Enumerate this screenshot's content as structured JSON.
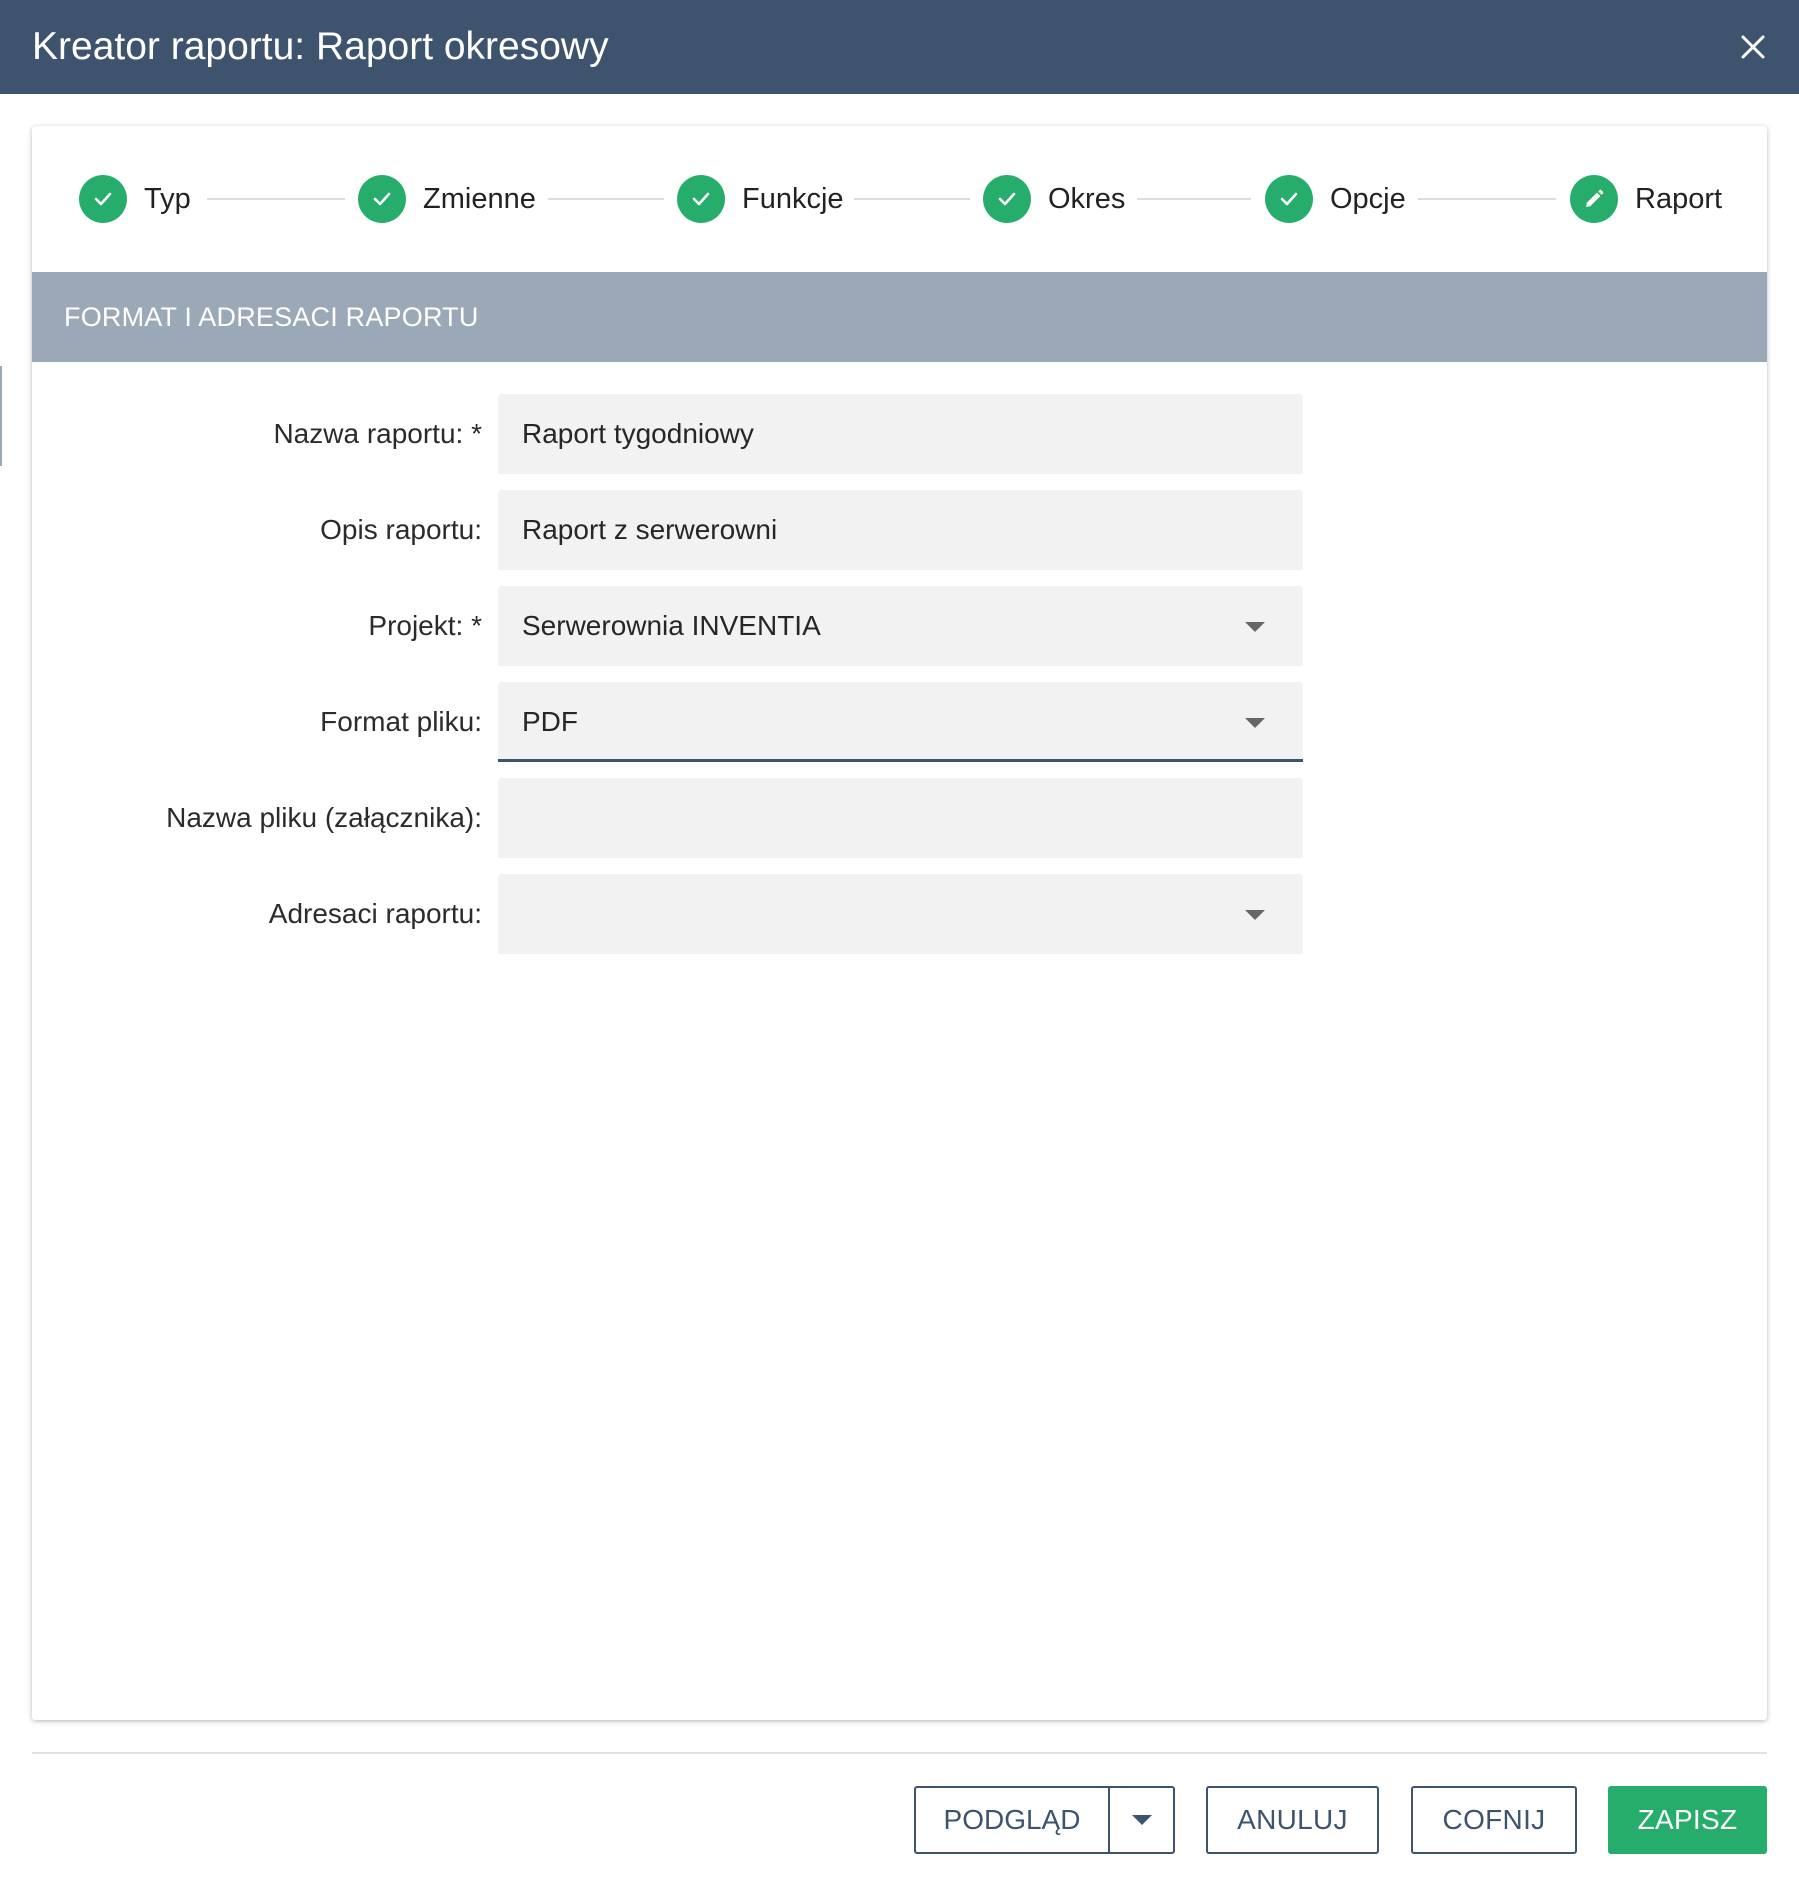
{
  "dialog": {
    "title": "Kreator raportu: Raport okresowy",
    "close_icon": "close-icon"
  },
  "stepper": {
    "steps": [
      {
        "label": "Typ",
        "state": "done",
        "icon": "check-icon"
      },
      {
        "label": "Zmienne",
        "state": "done",
        "icon": "check-icon"
      },
      {
        "label": "Funkcje",
        "state": "done",
        "icon": "check-icon"
      },
      {
        "label": "Okres",
        "state": "done",
        "icon": "check-icon"
      },
      {
        "label": "Opcje",
        "state": "done",
        "icon": "check-icon"
      },
      {
        "label": "Raport",
        "state": "active",
        "icon": "pencil-icon"
      }
    ]
  },
  "section": {
    "title": "FORMAT I ADRESACI RAPORTU"
  },
  "form": {
    "name": {
      "label": "Nazwa raportu: *",
      "value": "Raport tygodniowy"
    },
    "description": {
      "label": "Opis raportu:",
      "value": "Raport z serwerowni"
    },
    "project": {
      "label": "Projekt: *",
      "value": "Serwerownia INVENTIA"
    },
    "file_format": {
      "label": "Format pliku:",
      "value": "PDF"
    },
    "file_name": {
      "label": "Nazwa pliku (załącznika):",
      "value": ""
    },
    "recipients": {
      "label": "Adresaci raportu:",
      "value": ""
    }
  },
  "footer": {
    "preview_label": "PODGLĄD",
    "cancel_label": "ANULUJ",
    "back_label": "COFNIJ",
    "save_label": "ZAPISZ"
  },
  "colors": {
    "titlebar": "#3e536d",
    "section_header": "#9ba8b7",
    "success_green": "#27ad6b",
    "field_bg": "#f2f2f2"
  }
}
